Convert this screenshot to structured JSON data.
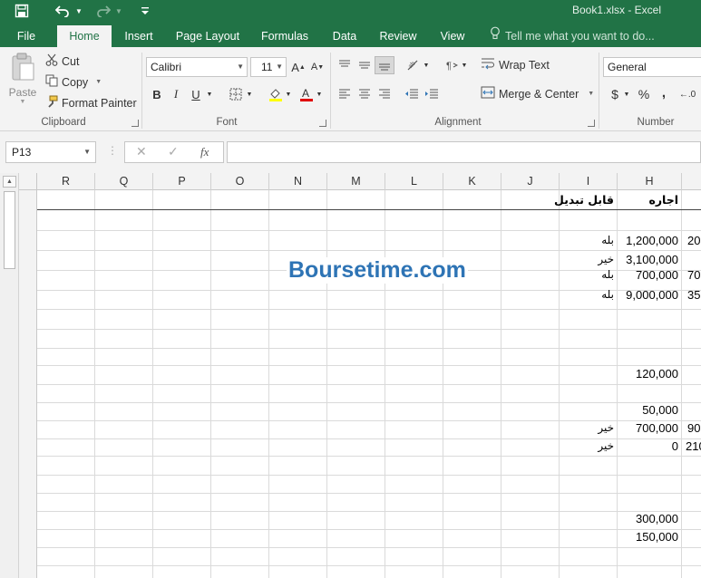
{
  "titlebar": {
    "title": "Book1.xlsx - Excel",
    "save_icon": "save-icon",
    "undo_icon": "undo-icon",
    "redo_icon": "redo-icon",
    "customize_icon": "customize-qat-icon",
    "bg_color": "#217346"
  },
  "tabs": {
    "file": "File",
    "home": "Home",
    "insert": "Insert",
    "page_layout": "Page Layout",
    "formulas": "Formulas",
    "data": "Data",
    "review": "Review",
    "view": "View",
    "tell_me": "Tell me what you want to do..."
  },
  "ribbon": {
    "clipboard": {
      "paste": "Paste",
      "cut": "Cut",
      "copy": "Copy",
      "format_painter": "Format Painter",
      "label": "Clipboard"
    },
    "font": {
      "font_name": "Calibri",
      "font_size": "11",
      "bold": "B",
      "italic": "I",
      "underline": "U",
      "label": "Font"
    },
    "alignment": {
      "wrap_text": "Wrap Text",
      "merge_center": "Merge & Center",
      "label": "Alignment"
    },
    "number": {
      "format": "General",
      "currency_symbol": "$",
      "percent_symbol": "%",
      "comma_symbol": ",",
      "label": "Number"
    }
  },
  "formula_bar": {
    "name_box": "P13",
    "cancel_icon": "cancel-icon",
    "enter_icon": "enter-icon",
    "fx": "fx",
    "value": ""
  },
  "columns": [
    "R",
    "Q",
    "P",
    "O",
    "N",
    "M",
    "L",
    "K",
    "J",
    "I",
    "H"
  ],
  "cells": {
    "header_I": "قابل تبدیل",
    "header_H": "اجاره",
    "r1_H": "1,200,000",
    "r1_I": "بله",
    "r1_G": "20",
    "r2_H": "3,100,000",
    "r2_I": "خیر",
    "r3_H": "700,000",
    "r3_I": "بله",
    "r3_G": "70",
    "r4_H": "9,000,000",
    "r4_I": "بله",
    "r4_G": "35",
    "r5_H": "120,000",
    "r6_H": "50,000",
    "r7_H": "700,000",
    "r7_I": "خیر",
    "r7_G": "90",
    "r8_H": "0",
    "r8_I": "خیر",
    "r8_G": "210",
    "r9_H": "300,000",
    "r10_H": "150,000"
  },
  "watermark": "Boursetime.com",
  "accent_color": "#217346",
  "watermark_color": "#2e74b5"
}
